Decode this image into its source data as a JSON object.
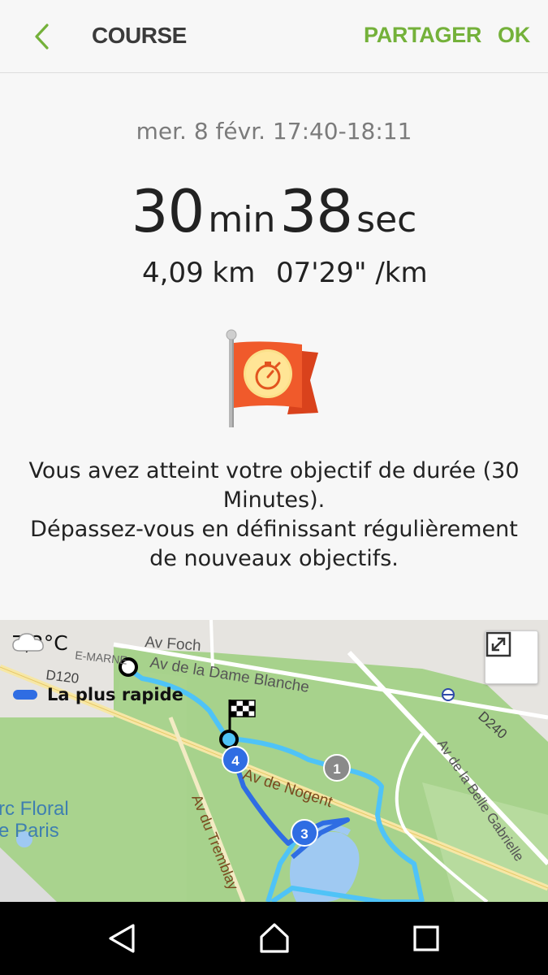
{
  "appbar": {
    "title": "COURSE",
    "share_label": "PARTAGER",
    "ok_label": "OK",
    "back_icon": "chevron-left-icon",
    "accent_color": "#74b13a"
  },
  "workout": {
    "datetime": "mer. 8 févr. 17:40-18:11",
    "minutes": "30",
    "minutes_unit": "min",
    "seconds": "38",
    "seconds_unit": "sec",
    "distance": "4,09 km",
    "pace": "07'29\" /km"
  },
  "achievement": {
    "icon": "stopwatch-flag-icon",
    "line1": "Vous avez atteint votre objectif de durée (30 Minutes).",
    "line2": "Dépassez-vous en définissant régulièrement de nouveaux objectifs."
  },
  "map": {
    "temperature": "7,2°C",
    "weather_icon": "cloud-icon",
    "legend_label": "La plus rapide",
    "legend_color": "#2f6de3",
    "route_color": "#4fc3f7",
    "labels": {
      "foch": "Av Foch",
      "marne": "E-MARNE",
      "dame_blanche": "Av de la Dame Blanche",
      "d120": "D120",
      "d240": "D240",
      "belle_gabrielle": "Av de la Belle Gabrielle",
      "nogent": "Av de Nogent",
      "tremblay": "Av du Tremblay",
      "parc_floral_1": "rc Floral",
      "parc_floral_2": "e Paris"
    },
    "markers": [
      "1",
      "3",
      "4"
    ],
    "expand_icon": "expand-icon"
  },
  "navbar": {
    "back_icon": "triangle-back-icon",
    "home_icon": "home-icon",
    "recent_icon": "recent-apps-icon"
  }
}
